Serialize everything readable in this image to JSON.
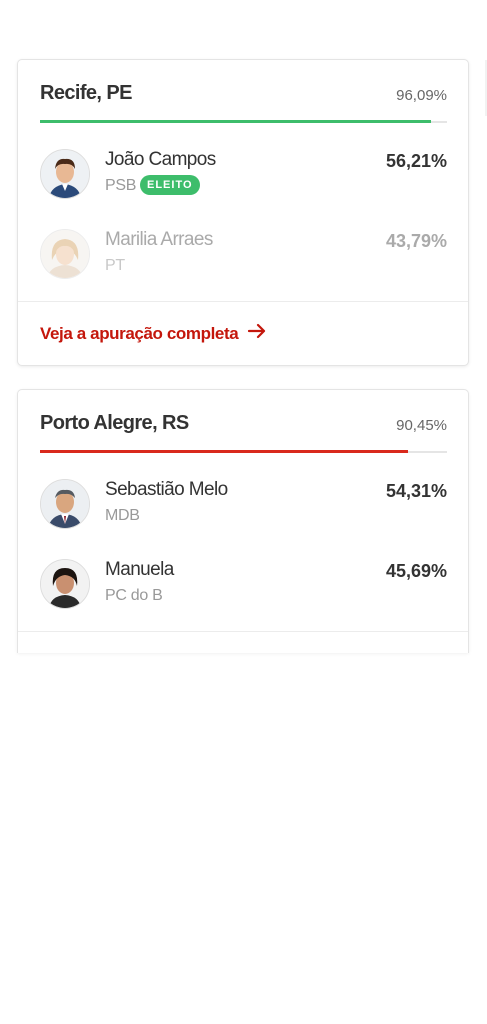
{
  "colors": {
    "winner_bar": "#3dbd6b",
    "leader_bar": "#d9291c",
    "link": "#c4170c",
    "badge": "#3dbd6b"
  },
  "cards": [
    {
      "city": "Recife, PE",
      "counted": "96,09%",
      "counted_fraction": 0.9609,
      "bar_color": "#3dbd6b",
      "candidates": [
        {
          "name": "João Campos",
          "party": "PSB",
          "percent": "56,21%",
          "badge": "ELEITO",
          "avatar_icon": "candidate-photo"
        },
        {
          "name": "Marilia Arraes",
          "party": "PT",
          "percent": "43,79%",
          "avatar_icon": "candidate-photo"
        }
      ],
      "link_label": "Veja a apuração completa"
    },
    {
      "city": "Porto Alegre, RS",
      "counted": "90,45%",
      "counted_fraction": 0.9045,
      "bar_color": "#d9291c",
      "candidates": [
        {
          "name": "Sebastião Melo",
          "party": "MDB",
          "percent": "54,31%",
          "avatar_icon": "candidate-photo"
        },
        {
          "name": "Manuela",
          "party": "PC do B",
          "percent": "45,69%",
          "avatar_icon": "candidate-photo"
        }
      ]
    }
  ]
}
